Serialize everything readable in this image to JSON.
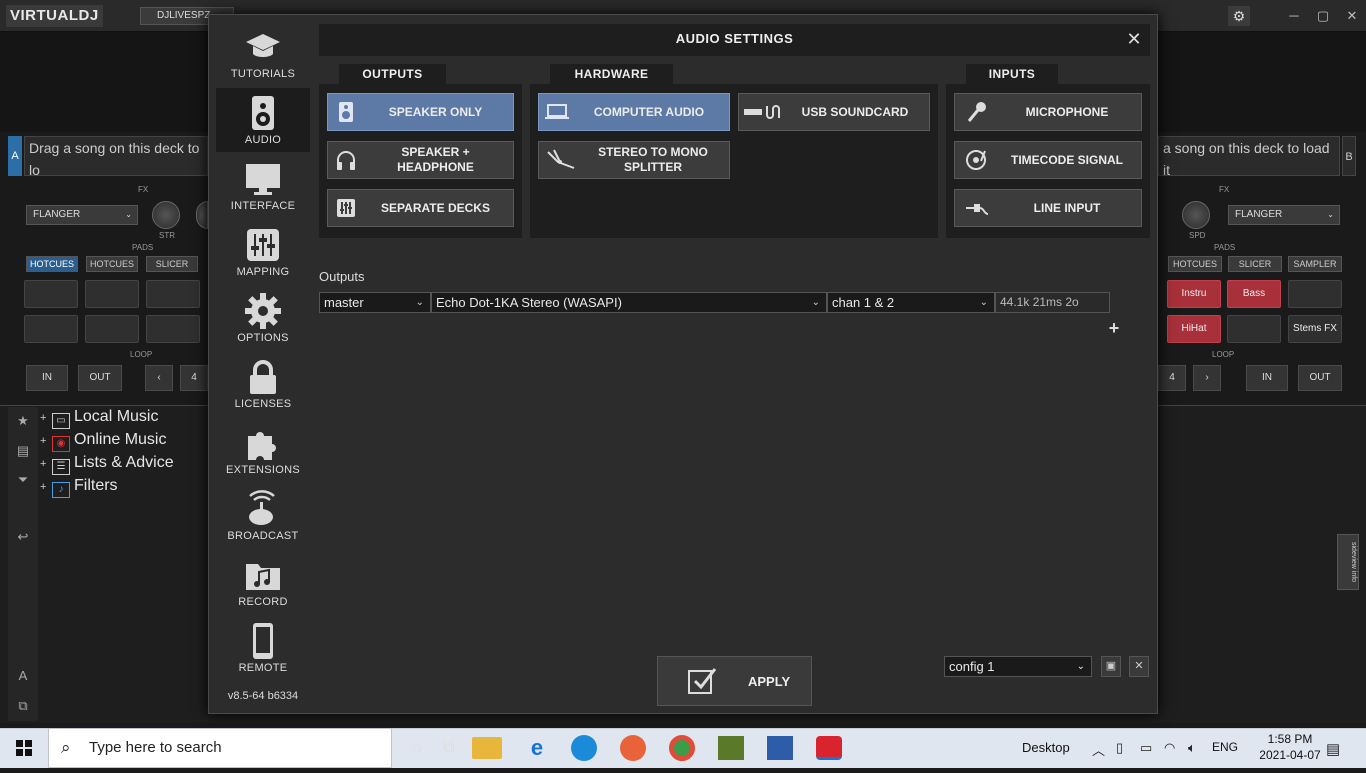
{
  "app": {
    "logo": "VIRTUALDJ",
    "user": "DJLIVESPZ",
    "deck_a_label": "A",
    "deck_b_label": "B",
    "deck_a_text": "Drag a song on this deck to lo",
    "deck_b_text": "a song on this deck to load it",
    "fx_label": "FX",
    "fx_select": "FLANGER",
    "knob_str": "STR",
    "knob_spd": "SPD",
    "pads_label": "PADS",
    "loop_label": "LOOP",
    "pad_modes_left": [
      "HOTCUES",
      "HOTCUES",
      "SLICER"
    ],
    "pad_modes_right": [
      "HOTCUES",
      "SLICER",
      "SAMPLER"
    ],
    "pads_right": [
      "Instru",
      "Bass",
      "",
      "HiHat",
      "",
      "Stems FX"
    ],
    "loop_in": "IN",
    "loop_out": "OUT",
    "loop_size_left": "4",
    "loop_size_right": "4",
    "browser_tree": [
      "Local Music",
      "Online Music",
      "Lists & Advice",
      "Filters"
    ],
    "info_tab": "sideview info"
  },
  "dialog": {
    "title": "AUDIO SETTINGS",
    "nav": [
      {
        "label": "TUTORIALS",
        "icon": "graduation-cap-icon"
      },
      {
        "label": "AUDIO",
        "icon": "speaker-icon",
        "active": true
      },
      {
        "label": "INTERFACE",
        "icon": "monitor-icon"
      },
      {
        "label": "MAPPING",
        "icon": "sliders-icon"
      },
      {
        "label": "OPTIONS",
        "icon": "gear-icon"
      },
      {
        "label": "LICENSES",
        "icon": "lock-icon"
      },
      {
        "label": "EXTENSIONS",
        "icon": "puzzle-icon"
      },
      {
        "label": "BROADCAST",
        "icon": "satellite-icon"
      },
      {
        "label": "RECORD",
        "icon": "music-folder-icon"
      },
      {
        "label": "REMOTE",
        "icon": "phone-icon"
      }
    ],
    "version": "v8.5-64 b6334",
    "groups": {
      "outputs": "OUTPUTS",
      "hardware": "HARDWARE",
      "inputs": "INPUTS"
    },
    "outputs_options": [
      "SPEAKER ONLY",
      "SPEAKER + HEADPHONE",
      "SEPARATE DECKS"
    ],
    "hardware_options": [
      "COMPUTER AUDIO",
      "USB SOUNDCARD",
      "STEREO TO MONO SPLITTER"
    ],
    "inputs_options": [
      "MICROPHONE",
      "TIMECODE SIGNAL",
      "LINE INPUT"
    ],
    "outputs_section_label": "Outputs",
    "output_row": {
      "target": "master",
      "device": "Echo Dot-1KA Stereo (WASAPI)",
      "channels": "chan 1 & 2",
      "latency": "44.1k 21ms 2o"
    },
    "apply_label": "APPLY",
    "config": "config 1",
    "selected_color": "#5d7aa6"
  },
  "taskbar": {
    "search_placeholder": "Type here to search",
    "desktop_label": "Desktop",
    "language": "ENG",
    "time": "1:58 PM",
    "date": "2021-04-07"
  }
}
